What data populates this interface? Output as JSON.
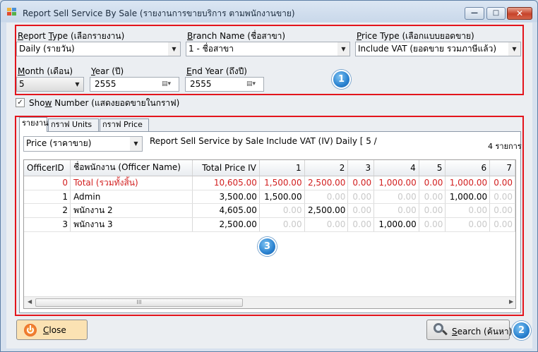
{
  "window": {
    "title": "Report Sell Service By Sale (รายงานการขายบริการ ตามพนักงานขาย)"
  },
  "filters": {
    "report_type": {
      "label_key": "R",
      "label_rest": "eport ",
      "label_key2": "T",
      "label_rest2": "ype (เลือกรายงาน)",
      "value": "Daily (รายวัน)"
    },
    "branch": {
      "label_key": "B",
      "label_rest": "ranch Name (ชื่อสาขา)",
      "value": "1 - ชื่อสาขา"
    },
    "price_type": {
      "label_key": "P",
      "label_rest": "rice Type (เลือกแบบยอดขาย)",
      "value": "Include VAT (ยอดขาย รวมภาษีแล้ว)"
    },
    "month": {
      "label_key": "M",
      "label_rest": "onth (เดือน)",
      "value": "5"
    },
    "year": {
      "label_key": "Y",
      "label_rest": "ear (ปี)",
      "value": "2555"
    },
    "end_year": {
      "label_key": "E",
      "label_rest": "nd Year (ถึงปี)",
      "value": "2555"
    }
  },
  "show_number": {
    "label_pre": "Sho",
    "label_key": "w",
    "label_rest": " Number (แสดงยอดขายในกราฟ)",
    "checked": true
  },
  "tabs": [
    "รายงาน",
    "กราฟ Units",
    "กราฟ Price"
  ],
  "report": {
    "mode_value": "Price (ราคาขาย)",
    "title": "Report Sell Service by Sale Include VAT (IV) Daily [ 5 /",
    "count": "4 รายการ"
  },
  "grid": {
    "columns": [
      "OfficerID",
      "ชื่อพนักงาน  (Officer Name)",
      "Total Price IV",
      "1",
      "2",
      "3",
      "4",
      "5",
      "6",
      "7"
    ],
    "rows": [
      {
        "id": "0",
        "name": "Total  (รวมทั้งสิ้น)",
        "total": "10,605.00",
        "days": [
          "1,500.00",
          "2,500.00",
          "0.00",
          "1,000.00",
          "0.00",
          "1,000.00",
          "0.00"
        ],
        "is_total": true
      },
      {
        "id": "1",
        "name": "Admin",
        "total": "3,500.00",
        "days": [
          "1,500.00",
          "0.00",
          "0.00",
          "0.00",
          "0.00",
          "1,000.00",
          "0.00"
        ],
        "is_total": false
      },
      {
        "id": "2",
        "name": "พนักงาน 2",
        "total": "4,605.00",
        "days": [
          "0.00",
          "2,500.00",
          "0.00",
          "0.00",
          "0.00",
          "0.00",
          "0.00"
        ],
        "is_total": false
      },
      {
        "id": "3",
        "name": "พนักงาน 3",
        "total": "2,500.00",
        "days": [
          "0.00",
          "0.00",
          "0.00",
          "1,000.00",
          "0.00",
          "0.00",
          "0.00"
        ],
        "is_total": false
      }
    ],
    "scroll_thumb": "III"
  },
  "buttons": {
    "close": {
      "key": "C",
      "rest": "lose"
    },
    "search": {
      "key": "S",
      "rest": "earch (ค้นหา)"
    }
  },
  "badges": [
    "1",
    "2",
    "3"
  ],
  "colors": {
    "highlight": "#e3141c",
    "total_row": "#d21f1f",
    "badge": "#2a82d0"
  }
}
